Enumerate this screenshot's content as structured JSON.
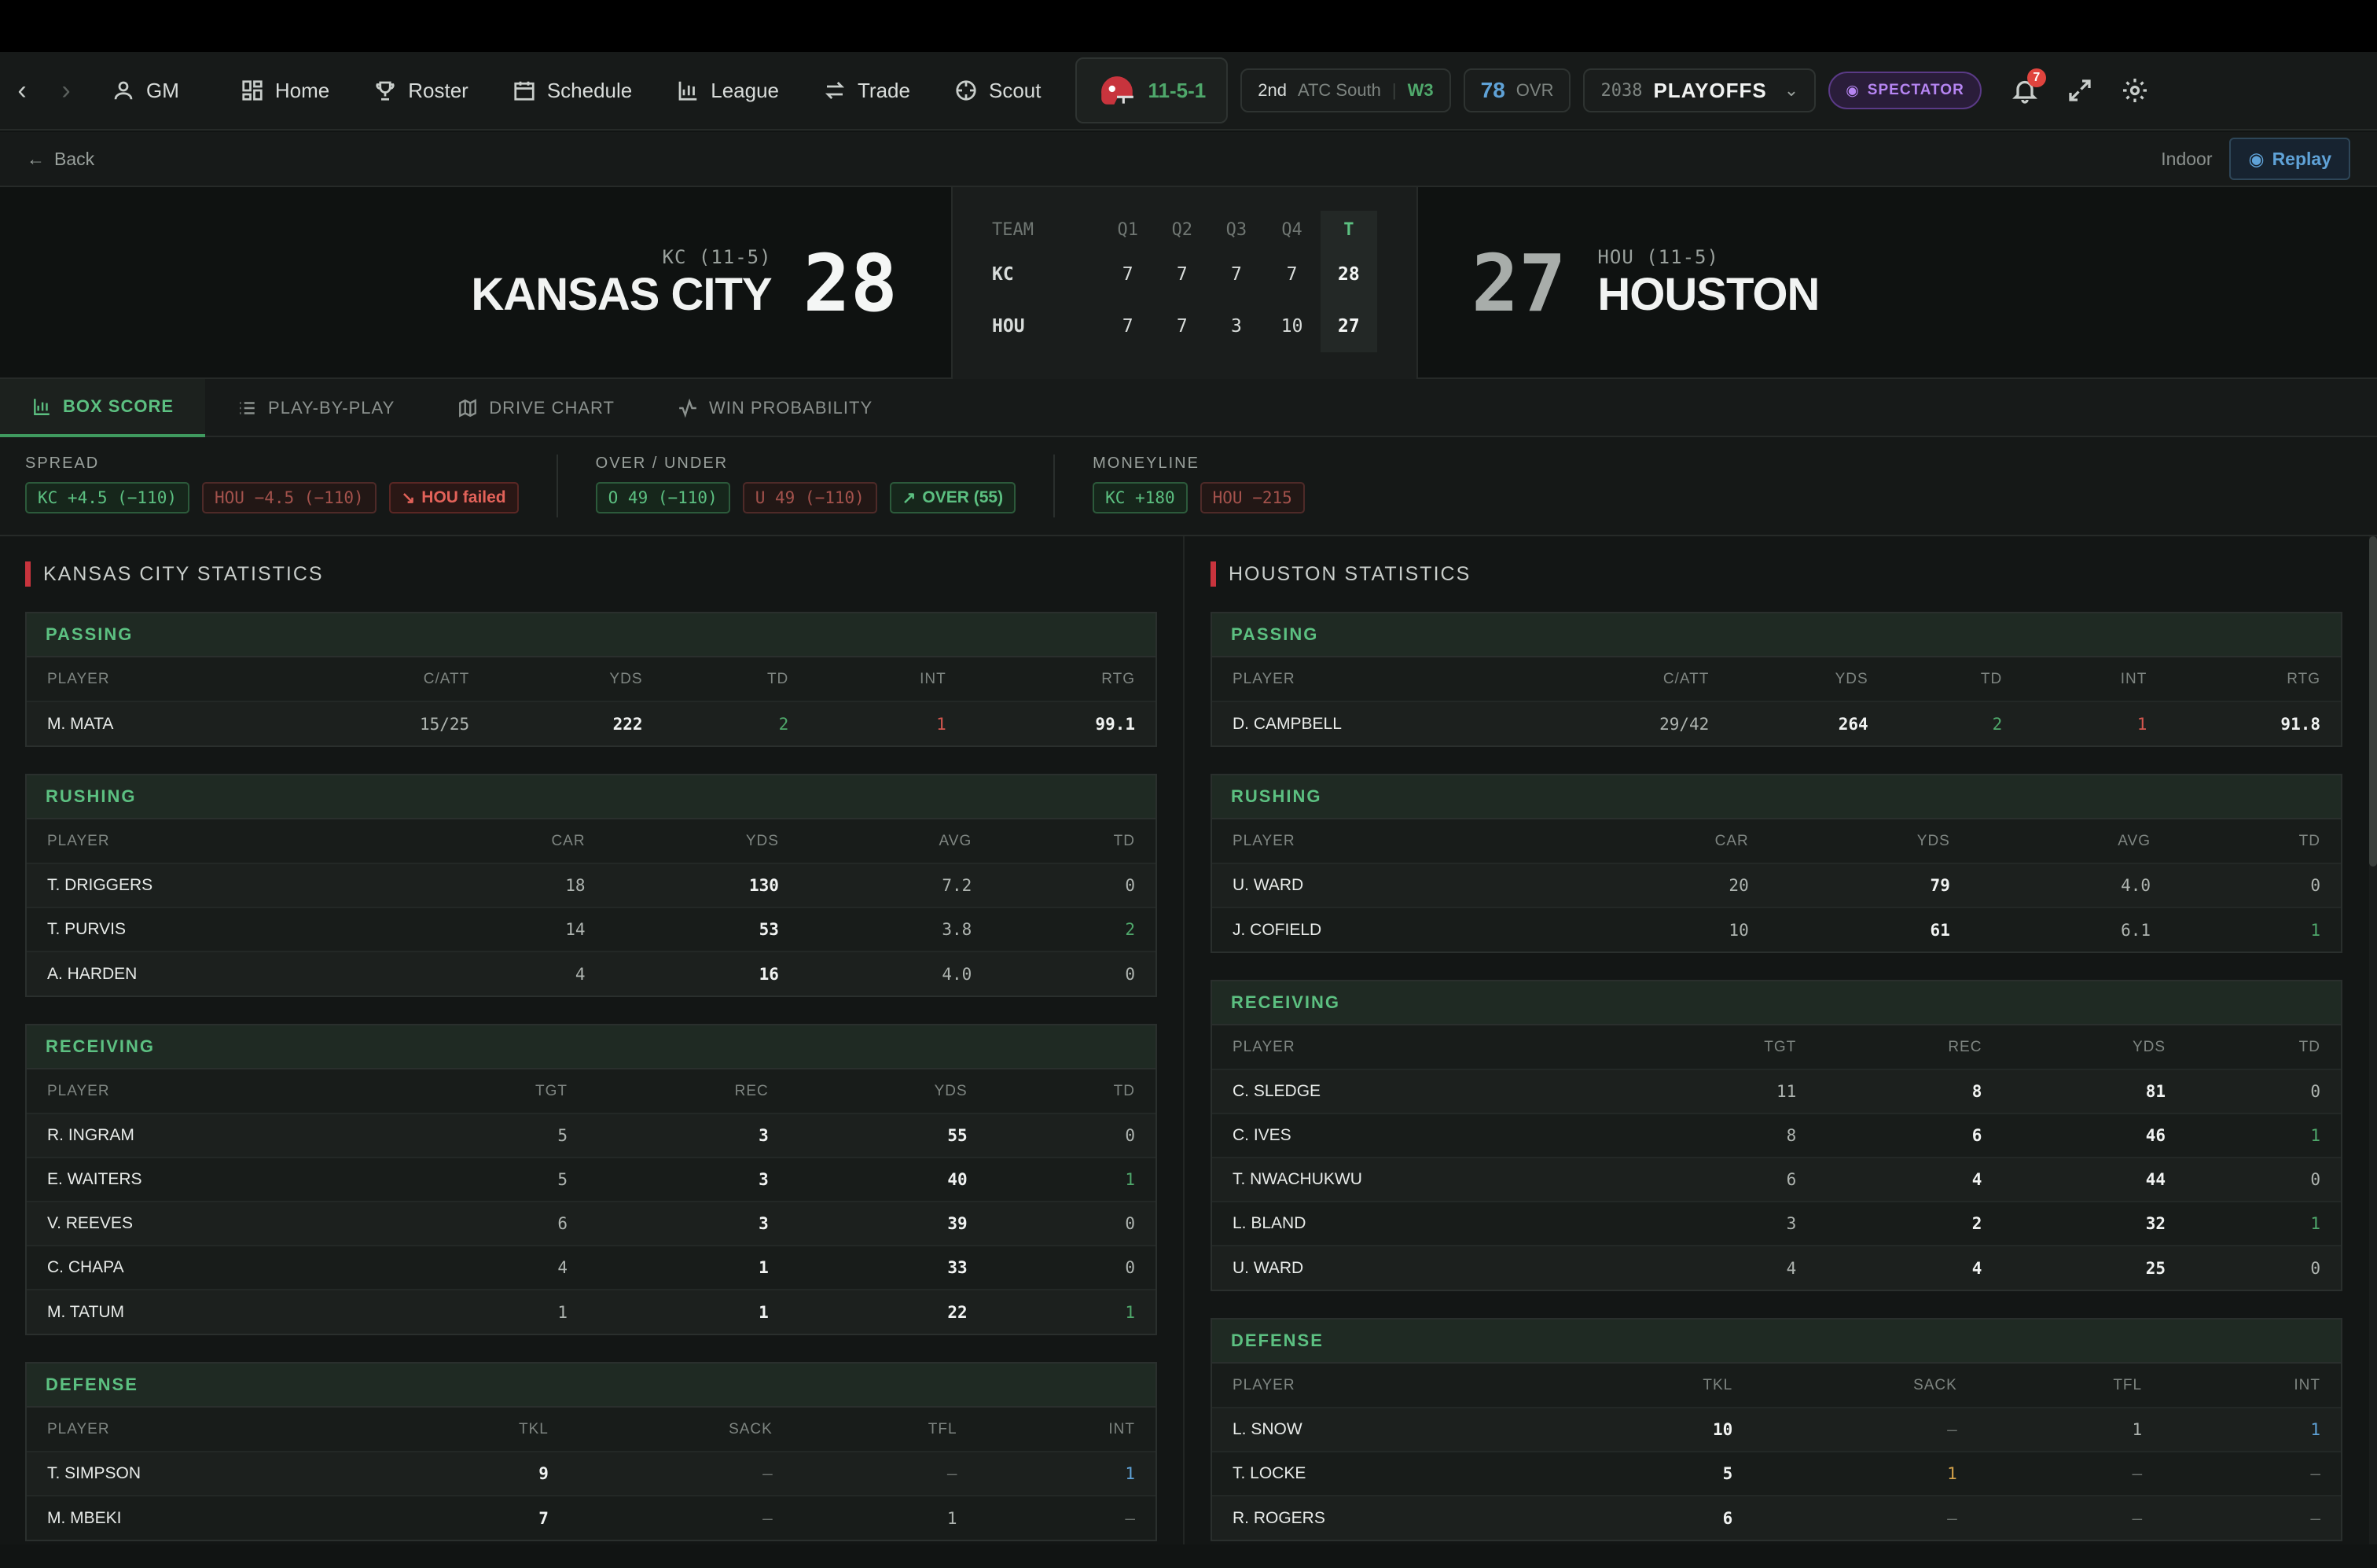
{
  "nav": {
    "gm": "GM",
    "items": [
      "Home",
      "Roster",
      "Schedule",
      "League",
      "Trade",
      "Scout"
    ],
    "record": "11-5-1",
    "standing_rank": "2nd",
    "standing_div": "ATC South",
    "streak": "W3",
    "ovr": "78",
    "ovr_label": "OVR",
    "season_year": "2038",
    "season_phase": "PLAYOFFS",
    "spectator": "SPECTATOR",
    "notif_count": "7"
  },
  "sub": {
    "back": "Back",
    "venue": "Indoor",
    "replay": "Replay"
  },
  "game": {
    "away": {
      "abbr_rec": "KC (11-5)",
      "name": "KANSAS CITY",
      "score": "28"
    },
    "home": {
      "abbr_rec": "HOU (11-5)",
      "name": "HOUSTON",
      "score": "27"
    },
    "line_headers": [
      "TEAM",
      "Q1",
      "Q2",
      "Q3",
      "Q4",
      "T"
    ],
    "line_rows": [
      [
        "KC",
        "7",
        "7",
        "7",
        "7",
        "28"
      ],
      [
        "HOU",
        "7",
        "7",
        "3",
        "10",
        "27"
      ]
    ]
  },
  "tabs": [
    "BOX SCORE",
    "PLAY-BY-PLAY",
    "DRIVE CHART",
    "WIN PROBABILITY"
  ],
  "bets": {
    "spread_label": "SPREAD",
    "spread": [
      "KC +4.5 (−110)",
      "HOU −4.5 (−110)",
      "HOU failed"
    ],
    "ou_label": "OVER / UNDER",
    "ou": [
      "O 49 (−110)",
      "U 49 (−110)",
      "OVER (55)"
    ],
    "ml_label": "MONEYLINE",
    "ml": [
      "KC +180",
      "HOU −215"
    ]
  },
  "kc": {
    "title": "KANSAS CITY STATISTICS",
    "passing": {
      "label": "PASSING",
      "headers": [
        "PLAYER",
        "C/ATT",
        "YDS",
        "TD",
        "INT",
        "RTG"
      ],
      "rows": [
        [
          "M. MATA",
          "15/25",
          "222",
          "2",
          "1",
          "99.1"
        ]
      ]
    },
    "rushing": {
      "label": "RUSHING",
      "headers": [
        "PLAYER",
        "CAR",
        "YDS",
        "AVG",
        "TD"
      ],
      "rows": [
        [
          "T. DRIGGERS",
          "18",
          "130",
          "7.2",
          "0"
        ],
        [
          "T. PURVIS",
          "14",
          "53",
          "3.8",
          "2"
        ],
        [
          "A. HARDEN",
          "4",
          "16",
          "4.0",
          "0"
        ]
      ]
    },
    "receiving": {
      "label": "RECEIVING",
      "headers": [
        "PLAYER",
        "TGT",
        "REC",
        "YDS",
        "TD"
      ],
      "rows": [
        [
          "R. INGRAM",
          "5",
          "3",
          "55",
          "0"
        ],
        [
          "E. WAITERS",
          "5",
          "3",
          "40",
          "1"
        ],
        [
          "V. REEVES",
          "6",
          "3",
          "39",
          "0"
        ],
        [
          "C. CHAPA",
          "4",
          "1",
          "33",
          "0"
        ],
        [
          "M. TATUM",
          "1",
          "1",
          "22",
          "1"
        ]
      ]
    },
    "defense": {
      "label": "DEFENSE",
      "headers": [
        "PLAYER",
        "TKL",
        "SACK",
        "TFL",
        "INT"
      ],
      "rows": [
        [
          "T. SIMPSON",
          "9",
          "–",
          "–",
          "1"
        ],
        [
          "M. MBEKI",
          "7",
          "–",
          "1",
          "–"
        ]
      ]
    }
  },
  "hou": {
    "title": "HOUSTON STATISTICS",
    "passing": {
      "label": "PASSING",
      "headers": [
        "PLAYER",
        "C/ATT",
        "YDS",
        "TD",
        "INT",
        "RTG"
      ],
      "rows": [
        [
          "D. CAMPBELL",
          "29/42",
          "264",
          "2",
          "1",
          "91.8"
        ]
      ]
    },
    "rushing": {
      "label": "RUSHING",
      "headers": [
        "PLAYER",
        "CAR",
        "YDS",
        "AVG",
        "TD"
      ],
      "rows": [
        [
          "U. WARD",
          "20",
          "79",
          "4.0",
          "0"
        ],
        [
          "J. COFIELD",
          "10",
          "61",
          "6.1",
          "1"
        ]
      ]
    },
    "receiving": {
      "label": "RECEIVING",
      "headers": [
        "PLAYER",
        "TGT",
        "REC",
        "YDS",
        "TD"
      ],
      "rows": [
        [
          "C. SLEDGE",
          "11",
          "8",
          "81",
          "0"
        ],
        [
          "C. IVES",
          "8",
          "6",
          "46",
          "1"
        ],
        [
          "T. NWACHUKWU",
          "6",
          "4",
          "44",
          "0"
        ],
        [
          "L. BLAND",
          "3",
          "2",
          "32",
          "1"
        ],
        [
          "U. WARD",
          "4",
          "4",
          "25",
          "0"
        ]
      ]
    },
    "defense": {
      "label": "DEFENSE",
      "headers": [
        "PLAYER",
        "TKL",
        "SACK",
        "TFL",
        "INT"
      ],
      "rows": [
        [
          "L. SNOW",
          "10",
          "–",
          "1",
          "1"
        ],
        [
          "T. LOCKE",
          "5",
          "1",
          "–",
          "–"
        ],
        [
          "R. ROGERS",
          "6",
          "–",
          "–",
          "–"
        ]
      ]
    }
  }
}
